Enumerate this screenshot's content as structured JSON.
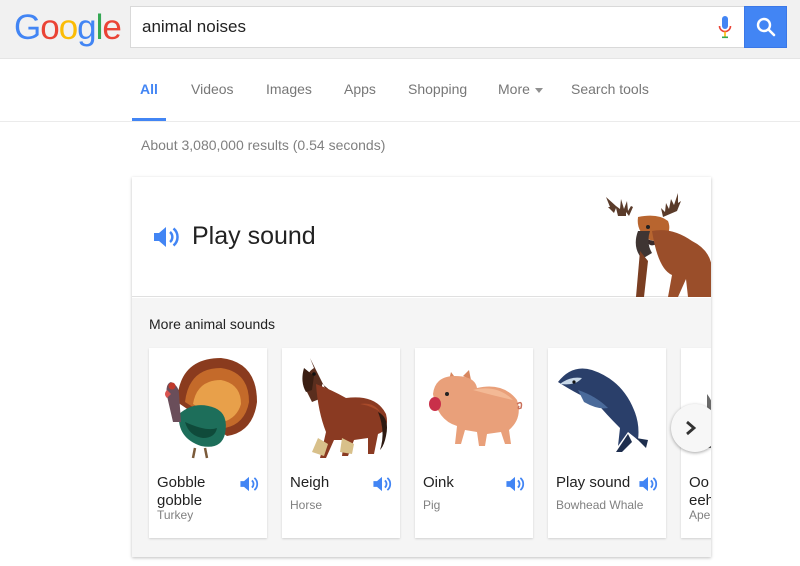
{
  "logo": {
    "letters": [
      "G",
      "o",
      "o",
      "g",
      "l",
      "e"
    ],
    "colors": [
      "#4285f4",
      "#ea4335",
      "#fbbc05",
      "#4285f4",
      "#34a853",
      "#ea4335"
    ]
  },
  "search": {
    "query": "animal noises",
    "icons": {
      "mic": "microphone-icon",
      "submit": "magnifier-icon"
    },
    "accent": "#4285f4"
  },
  "tabs": {
    "all": "All",
    "videos": "Videos",
    "images": "Images",
    "apps": "Apps",
    "shopping": "Shopping",
    "more": "More",
    "tools": "Search tools"
  },
  "results": {
    "stats": "About 3,080,000 results (0.54 seconds)"
  },
  "card": {
    "play_label": "Play sound",
    "hero_animal": "moose-illustration",
    "more_title": "More animal sounds",
    "animals": [
      {
        "name": "Gobble gobble",
        "sub": "Turkey",
        "icon": "turkey-illustration"
      },
      {
        "name": "Neigh",
        "sub": "Horse",
        "icon": "horse-illustration"
      },
      {
        "name": "Oink",
        "sub": "Pig",
        "icon": "pig-illustration"
      },
      {
        "name": "Play sound",
        "sub": "Bowhead Whale",
        "icon": "whale-illustration"
      },
      {
        "name": "Oo eeh",
        "sub": "Ape",
        "icon": "ape-illustration"
      }
    ]
  }
}
